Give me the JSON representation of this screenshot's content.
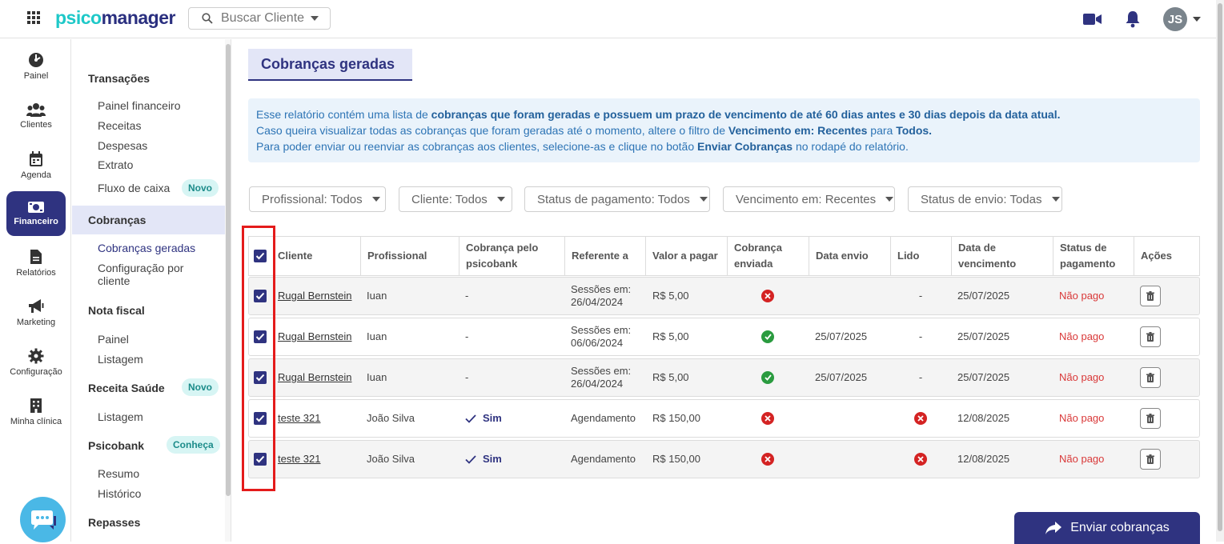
{
  "app": {
    "logo_part1": "psico",
    "logo_part2": "manager",
    "search_placeholder": "Buscar Cliente",
    "user_initials": "JS"
  },
  "leftnav": [
    {
      "label": "Painel",
      "icon": "dashboard-icon"
    },
    {
      "label": "Clientes",
      "icon": "users-icon"
    },
    {
      "label": "Agenda",
      "icon": "calendar-icon"
    },
    {
      "label": "Financeiro",
      "icon": "money-icon",
      "active": true
    },
    {
      "label": "Relatórios",
      "icon": "document-icon"
    },
    {
      "label": "Marketing",
      "icon": "megaphone-icon"
    },
    {
      "label": "Configuração",
      "icon": "gear-icon"
    },
    {
      "label": "Minha clínica",
      "icon": "building-icon"
    }
  ],
  "subnav": {
    "transacoes": "Transações",
    "painel_financeiro": "Painel financeiro",
    "receitas": "Receitas",
    "despesas": "Despesas",
    "extrato": "Extrato",
    "fluxo_caixa": "Fluxo de caixa",
    "badge_novo": "Novo",
    "cobrancas": "Cobranças",
    "cobrancas_geradas": "Cobranças geradas",
    "configuracao_por": "Configuração por",
    "cliente": "cliente",
    "nota_fiscal": "Nota fiscal",
    "nf_painel": "Painel",
    "nf_listagem": "Listagem",
    "receita_saude": "Receita Saúde",
    "rs_listagem": "Listagem",
    "psicobank": "Psicobank",
    "badge_conheca": "Conheça",
    "resumo": "Resumo",
    "historico": "Histórico",
    "repasses": "Repasses"
  },
  "main": {
    "title": "Cobranças geradas",
    "info": {
      "l1a": "Esse relatório contém uma lista de ",
      "l1b": "cobranças que foram geradas e possuem um prazo de vencimento de até 60 dias antes e 30 dias depois da data atual.",
      "l2a": "Caso queira visualizar todas as cobranças que foram geradas até o momento, altere o filtro de ",
      "l2b": "Vencimento em: Recentes",
      "l2c": " para ",
      "l2d": "Todos.",
      "l3a": "Para poder enviar ou reenviar as cobranças aos clientes, selecione-as e clique no botão ",
      "l3b": "Enviar Cobranças",
      "l3c": " no rodapé do relatório."
    },
    "filters": [
      "Profissional: Todos",
      "Cliente: Todos",
      "Status de pagamento: Todos",
      "Vencimento em: Recentes",
      "Status de envio: Todas"
    ],
    "columns": {
      "cliente": "Cliente",
      "profissional": "Profissional",
      "cobranca_psicobank_1": "Cobrança pelo",
      "cobranca_psicobank_2": "psicobank",
      "referente": "Referente a",
      "valor": "Valor a pagar",
      "enviada_1": "Cobrança",
      "enviada_2": "enviada",
      "data_envio": "Data envio",
      "lido": "Lido",
      "vencimento_1": "Data de",
      "vencimento_2": "vencimento",
      "status_1": "Status de",
      "status_2": "pagamento",
      "acoes": "Ações"
    },
    "rows": [
      {
        "cliente": "Rugal Bernstein",
        "profissional": "Iuan",
        "psicobank": "-",
        "psicobank_sim": false,
        "ref1": "Sessões em:",
        "ref2": "26/04/2024",
        "valor": "R$ 5,00",
        "enviada": false,
        "data_envio": "",
        "lido": "-",
        "lido_icon": false,
        "vencimento": "25/07/2025",
        "status": "Não pago"
      },
      {
        "cliente": "Rugal Bernstein",
        "profissional": "Iuan",
        "psicobank": "-",
        "psicobank_sim": false,
        "ref1": "Sessões em:",
        "ref2": "06/06/2024",
        "valor": "R$ 5,00",
        "enviada": true,
        "data_envio": "25/07/2025",
        "lido": "-",
        "lido_icon": false,
        "vencimento": "25/07/2025",
        "status": "Não pago"
      },
      {
        "cliente": "Rugal Bernstein",
        "profissional": "Iuan",
        "psicobank": "-",
        "psicobank_sim": false,
        "ref1": "Sessões em:",
        "ref2": "26/04/2024",
        "valor": "R$ 5,00",
        "enviada": true,
        "data_envio": "25/07/2025",
        "lido": "-",
        "lido_icon": false,
        "vencimento": "25/07/2025",
        "status": "Não pago"
      },
      {
        "cliente": "teste 321",
        "profissional": "João Silva",
        "psicobank": "Sim",
        "psicobank_sim": true,
        "ref1": "Agendamento",
        "ref2": "",
        "valor": "R$ 150,00",
        "enviada": false,
        "data_envio": "",
        "lido": "",
        "lido_icon": true,
        "vencimento": "12/08/2025",
        "status": "Não pago"
      },
      {
        "cliente": "teste 321",
        "profissional": "João Silva",
        "psicobank": "Sim",
        "psicobank_sim": true,
        "ref1": "Agendamento",
        "ref2": "",
        "valor": "R$ 150,00",
        "enviada": false,
        "data_envio": "",
        "lido": "",
        "lido_icon": true,
        "vencimento": "12/08/2025",
        "status": "Não pago"
      }
    ],
    "send_button": "Enviar cobranças"
  },
  "colors": {
    "primary": "#2f3380",
    "accent": "#1ec8c8",
    "unpaid": "#d93838",
    "highlight": "#e41b1b"
  }
}
